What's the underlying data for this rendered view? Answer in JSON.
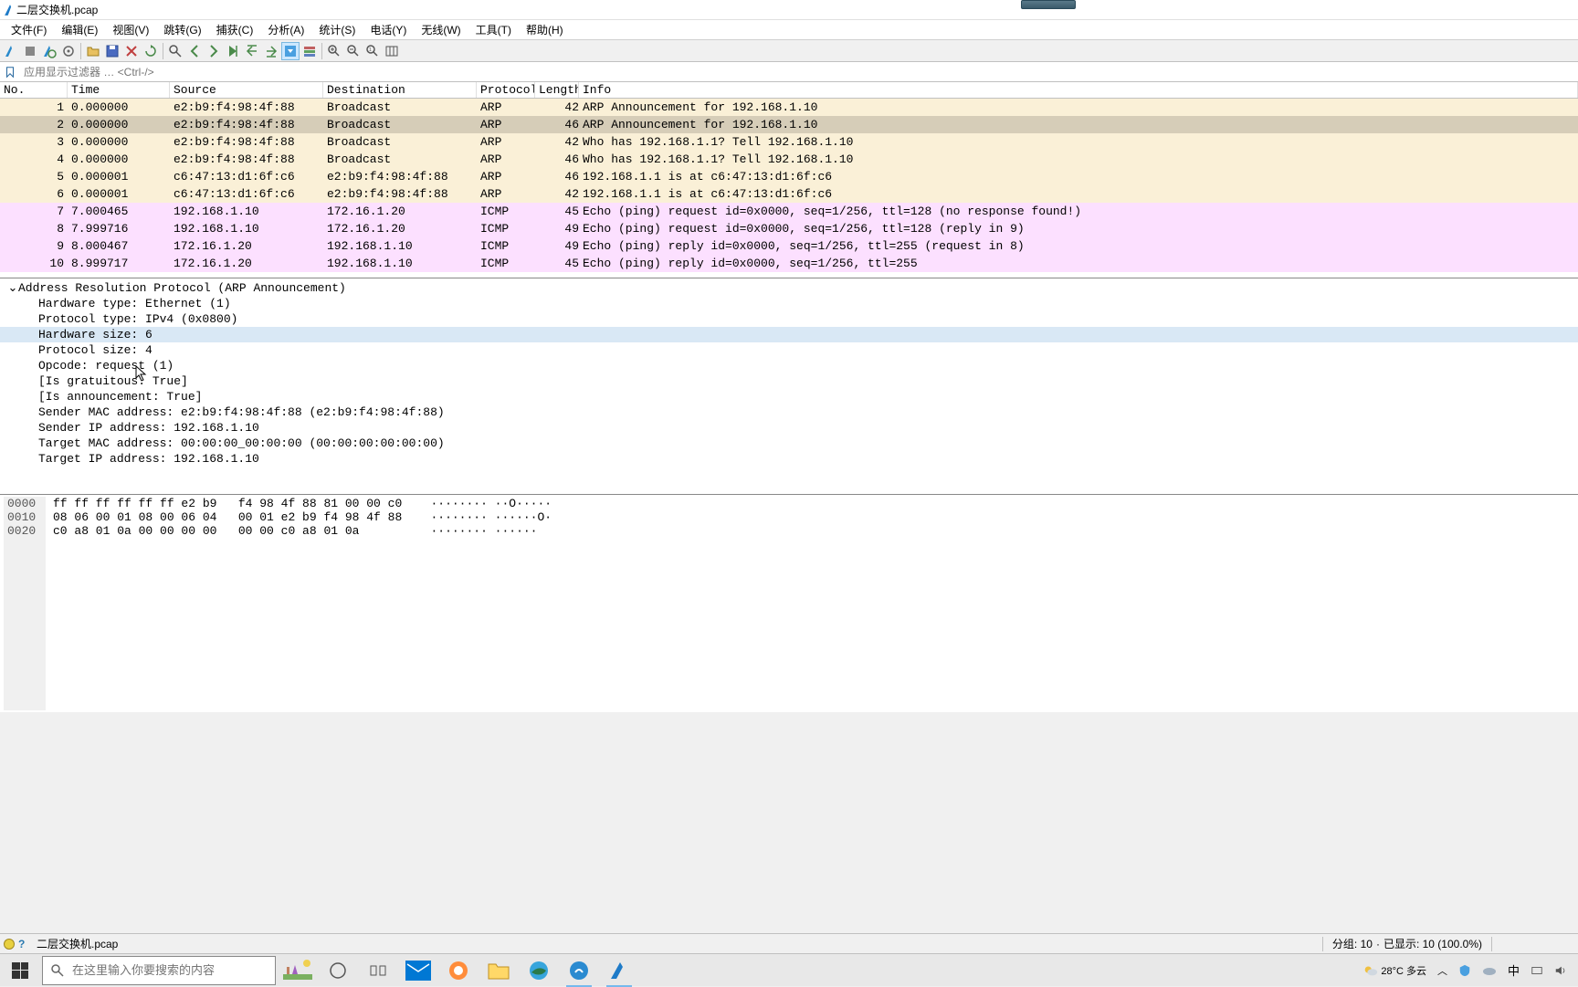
{
  "window": {
    "title": "二层交换机.pcap"
  },
  "menu": [
    "文件(F)",
    "编辑(E)",
    "视图(V)",
    "跳转(G)",
    "捕获(C)",
    "分析(A)",
    "统计(S)",
    "电话(Y)",
    "无线(W)",
    "工具(T)",
    "帮助(H)"
  ],
  "filter": {
    "placeholder": "应用显示过滤器 … <Ctrl-/>"
  },
  "columns": {
    "no": "No.",
    "time": "Time",
    "src": "Source",
    "dst": "Destination",
    "proto": "Protocol",
    "len": "Length",
    "info": "Info"
  },
  "packets": [
    {
      "no": "1",
      "time": "0.000000",
      "src": "e2:b9:f4:98:4f:88",
      "dst": "Broadcast",
      "proto": "ARP",
      "len": "42",
      "info": "ARP Announcement for 192.168.1.10",
      "cls": "arp"
    },
    {
      "no": "2",
      "time": "0.000000",
      "src": "e2:b9:f4:98:4f:88",
      "dst": "Broadcast",
      "proto": "ARP",
      "len": "46",
      "info": "ARP Announcement for 192.168.1.10",
      "cls": "arp-sel"
    },
    {
      "no": "3",
      "time": "0.000000",
      "src": "e2:b9:f4:98:4f:88",
      "dst": "Broadcast",
      "proto": "ARP",
      "len": "42",
      "info": "Who has 192.168.1.1? Tell 192.168.1.10",
      "cls": "arp"
    },
    {
      "no": "4",
      "time": "0.000000",
      "src": "e2:b9:f4:98:4f:88",
      "dst": "Broadcast",
      "proto": "ARP",
      "len": "46",
      "info": "Who has 192.168.1.1? Tell 192.168.1.10",
      "cls": "arp"
    },
    {
      "no": "5",
      "time": "0.000001",
      "src": "c6:47:13:d1:6f:c6",
      "dst": "e2:b9:f4:98:4f:88",
      "proto": "ARP",
      "len": "46",
      "info": "192.168.1.1 is at c6:47:13:d1:6f:c6",
      "cls": "arp"
    },
    {
      "no": "6",
      "time": "0.000001",
      "src": "c6:47:13:d1:6f:c6",
      "dst": "e2:b9:f4:98:4f:88",
      "proto": "ARP",
      "len": "42",
      "info": "192.168.1.1 is at c6:47:13:d1:6f:c6",
      "cls": "arp"
    },
    {
      "no": "7",
      "time": "7.000465",
      "src": "192.168.1.10",
      "dst": "172.16.1.20",
      "proto": "ICMP",
      "len": "45",
      "info": "Echo (ping) request  id=0x0000, seq=1/256, ttl=128 (no response found!)",
      "cls": "icmp"
    },
    {
      "no": "8",
      "time": "7.999716",
      "src": "192.168.1.10",
      "dst": "172.16.1.20",
      "proto": "ICMP",
      "len": "49",
      "info": "Echo (ping) request  id=0x0000, seq=1/256, ttl=128 (reply in 9)",
      "cls": "icmp"
    },
    {
      "no": "9",
      "time": "8.000467",
      "src": "172.16.1.20",
      "dst": "192.168.1.10",
      "proto": "ICMP",
      "len": "49",
      "info": "Echo (ping) reply    id=0x0000, seq=1/256, ttl=255 (request in 8)",
      "cls": "icmp"
    },
    {
      "no": "10",
      "time": "8.999717",
      "src": "172.16.1.20",
      "dst": "192.168.1.10",
      "proto": "ICMP",
      "len": "45",
      "info": "Echo (ping) reply    id=0x0000, seq=1/256, ttl=255",
      "cls": "icmp"
    }
  ],
  "details": {
    "header": "Address Resolution Protocol (ARP Announcement)",
    "lines": [
      {
        "t": "Hardware type: Ethernet (1)",
        "hl": false
      },
      {
        "t": "Protocol type: IPv4 (0x0800)",
        "hl": false
      },
      {
        "t": "Hardware size: 6",
        "hl": true
      },
      {
        "t": "Protocol size: 4",
        "hl": false
      },
      {
        "t": "Opcode: request (1)",
        "hl": false
      },
      {
        "t": "[Is gratuitous: True]",
        "hl": false
      },
      {
        "t": "[Is announcement: True]",
        "hl": false
      },
      {
        "t": "Sender MAC address: e2:b9:f4:98:4f:88 (e2:b9:f4:98:4f:88)",
        "hl": false
      },
      {
        "t": "Sender IP address: 192.168.1.10",
        "hl": false
      },
      {
        "t": "Target MAC address: 00:00:00_00:00:00 (00:00:00:00:00:00)",
        "hl": false
      },
      {
        "t": "Target IP address: 192.168.1.10",
        "hl": false
      }
    ]
  },
  "hex": {
    "offsets": [
      "0000",
      "0010",
      "0020"
    ],
    "rows": [
      "ff ff ff ff ff ff e2 b9   f4 98 4f 88 81 00 00 c0    ········ ··O·····",
      "08 06 00 01 08 00 06 04   00 01 e2 b9 f4 98 4f 88    ········ ······O·",
      "c0 a8 01 0a 00 00 00 00   00 00 c0 a8 01 0a          ········ ······"
    ]
  },
  "status": {
    "file": "二层交换机.pcap",
    "packets": "分组: 10",
    "displayed": "已显示: 10 (100.0%)"
  },
  "taskbar": {
    "search_placeholder": "在这里输入你要搜索的内容",
    "weather": "28°C 多云"
  }
}
